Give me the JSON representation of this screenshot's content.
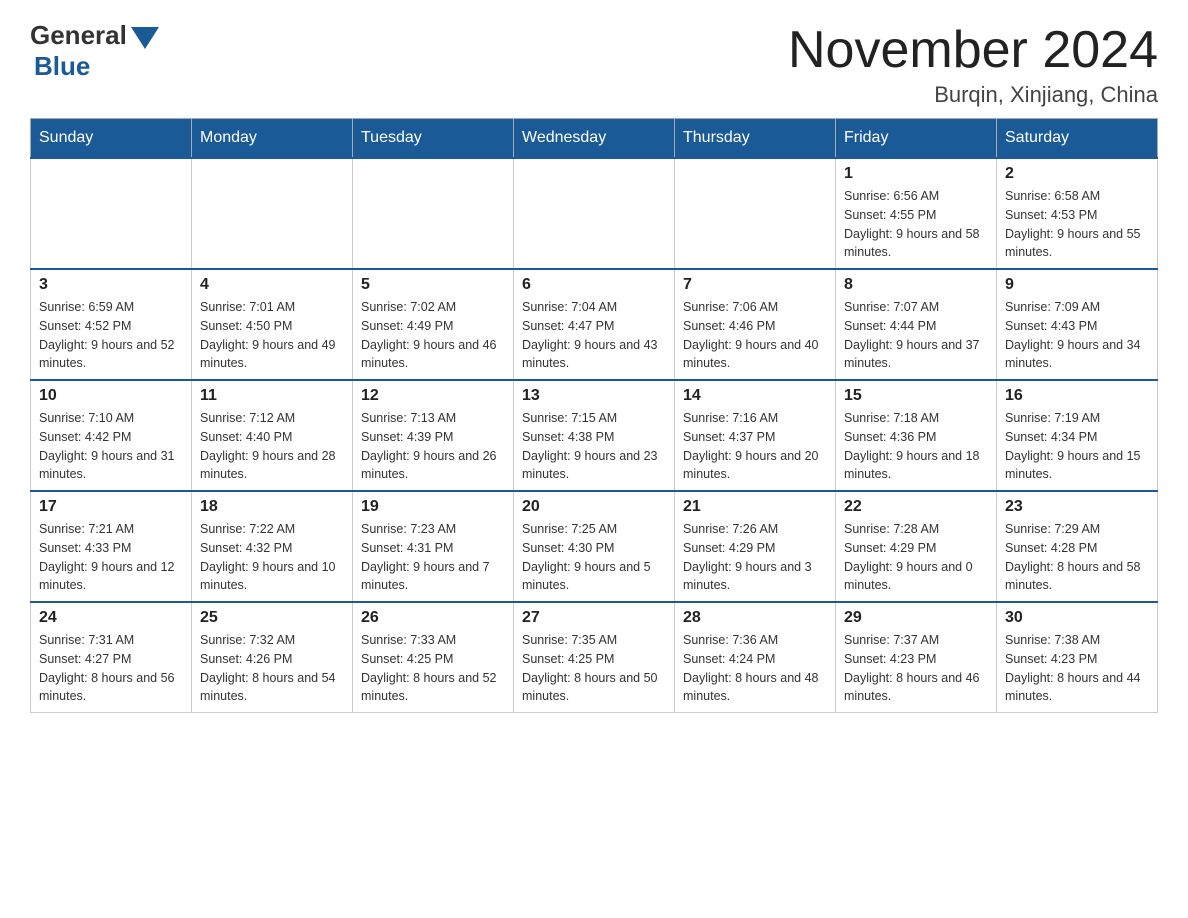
{
  "header": {
    "logo_general": "General",
    "logo_blue": "Blue",
    "month_title": "November 2024",
    "location": "Burqin, Xinjiang, China"
  },
  "weekdays": [
    "Sunday",
    "Monday",
    "Tuesday",
    "Wednesday",
    "Thursday",
    "Friday",
    "Saturday"
  ],
  "weeks": [
    {
      "days": [
        {
          "num": "",
          "empty": true
        },
        {
          "num": "",
          "empty": true
        },
        {
          "num": "",
          "empty": true
        },
        {
          "num": "",
          "empty": true
        },
        {
          "num": "",
          "empty": true
        },
        {
          "num": "1",
          "sunrise": "Sunrise: 6:56 AM",
          "sunset": "Sunset: 4:55 PM",
          "daylight": "Daylight: 9 hours and 58 minutes."
        },
        {
          "num": "2",
          "sunrise": "Sunrise: 6:58 AM",
          "sunset": "Sunset: 4:53 PM",
          "daylight": "Daylight: 9 hours and 55 minutes."
        }
      ]
    },
    {
      "days": [
        {
          "num": "3",
          "sunrise": "Sunrise: 6:59 AM",
          "sunset": "Sunset: 4:52 PM",
          "daylight": "Daylight: 9 hours and 52 minutes."
        },
        {
          "num": "4",
          "sunrise": "Sunrise: 7:01 AM",
          "sunset": "Sunset: 4:50 PM",
          "daylight": "Daylight: 9 hours and 49 minutes."
        },
        {
          "num": "5",
          "sunrise": "Sunrise: 7:02 AM",
          "sunset": "Sunset: 4:49 PM",
          "daylight": "Daylight: 9 hours and 46 minutes."
        },
        {
          "num": "6",
          "sunrise": "Sunrise: 7:04 AM",
          "sunset": "Sunset: 4:47 PM",
          "daylight": "Daylight: 9 hours and 43 minutes."
        },
        {
          "num": "7",
          "sunrise": "Sunrise: 7:06 AM",
          "sunset": "Sunset: 4:46 PM",
          "daylight": "Daylight: 9 hours and 40 minutes."
        },
        {
          "num": "8",
          "sunrise": "Sunrise: 7:07 AM",
          "sunset": "Sunset: 4:44 PM",
          "daylight": "Daylight: 9 hours and 37 minutes."
        },
        {
          "num": "9",
          "sunrise": "Sunrise: 7:09 AM",
          "sunset": "Sunset: 4:43 PM",
          "daylight": "Daylight: 9 hours and 34 minutes."
        }
      ]
    },
    {
      "days": [
        {
          "num": "10",
          "sunrise": "Sunrise: 7:10 AM",
          "sunset": "Sunset: 4:42 PM",
          "daylight": "Daylight: 9 hours and 31 minutes."
        },
        {
          "num": "11",
          "sunrise": "Sunrise: 7:12 AM",
          "sunset": "Sunset: 4:40 PM",
          "daylight": "Daylight: 9 hours and 28 minutes."
        },
        {
          "num": "12",
          "sunrise": "Sunrise: 7:13 AM",
          "sunset": "Sunset: 4:39 PM",
          "daylight": "Daylight: 9 hours and 26 minutes."
        },
        {
          "num": "13",
          "sunrise": "Sunrise: 7:15 AM",
          "sunset": "Sunset: 4:38 PM",
          "daylight": "Daylight: 9 hours and 23 minutes."
        },
        {
          "num": "14",
          "sunrise": "Sunrise: 7:16 AM",
          "sunset": "Sunset: 4:37 PM",
          "daylight": "Daylight: 9 hours and 20 minutes."
        },
        {
          "num": "15",
          "sunrise": "Sunrise: 7:18 AM",
          "sunset": "Sunset: 4:36 PM",
          "daylight": "Daylight: 9 hours and 18 minutes."
        },
        {
          "num": "16",
          "sunrise": "Sunrise: 7:19 AM",
          "sunset": "Sunset: 4:34 PM",
          "daylight": "Daylight: 9 hours and 15 minutes."
        }
      ]
    },
    {
      "days": [
        {
          "num": "17",
          "sunrise": "Sunrise: 7:21 AM",
          "sunset": "Sunset: 4:33 PM",
          "daylight": "Daylight: 9 hours and 12 minutes."
        },
        {
          "num": "18",
          "sunrise": "Sunrise: 7:22 AM",
          "sunset": "Sunset: 4:32 PM",
          "daylight": "Daylight: 9 hours and 10 minutes."
        },
        {
          "num": "19",
          "sunrise": "Sunrise: 7:23 AM",
          "sunset": "Sunset: 4:31 PM",
          "daylight": "Daylight: 9 hours and 7 minutes."
        },
        {
          "num": "20",
          "sunrise": "Sunrise: 7:25 AM",
          "sunset": "Sunset: 4:30 PM",
          "daylight": "Daylight: 9 hours and 5 minutes."
        },
        {
          "num": "21",
          "sunrise": "Sunrise: 7:26 AM",
          "sunset": "Sunset: 4:29 PM",
          "daylight": "Daylight: 9 hours and 3 minutes."
        },
        {
          "num": "22",
          "sunrise": "Sunrise: 7:28 AM",
          "sunset": "Sunset: 4:29 PM",
          "daylight": "Daylight: 9 hours and 0 minutes."
        },
        {
          "num": "23",
          "sunrise": "Sunrise: 7:29 AM",
          "sunset": "Sunset: 4:28 PM",
          "daylight": "Daylight: 8 hours and 58 minutes."
        }
      ]
    },
    {
      "days": [
        {
          "num": "24",
          "sunrise": "Sunrise: 7:31 AM",
          "sunset": "Sunset: 4:27 PM",
          "daylight": "Daylight: 8 hours and 56 minutes."
        },
        {
          "num": "25",
          "sunrise": "Sunrise: 7:32 AM",
          "sunset": "Sunset: 4:26 PM",
          "daylight": "Daylight: 8 hours and 54 minutes."
        },
        {
          "num": "26",
          "sunrise": "Sunrise: 7:33 AM",
          "sunset": "Sunset: 4:25 PM",
          "daylight": "Daylight: 8 hours and 52 minutes."
        },
        {
          "num": "27",
          "sunrise": "Sunrise: 7:35 AM",
          "sunset": "Sunset: 4:25 PM",
          "daylight": "Daylight: 8 hours and 50 minutes."
        },
        {
          "num": "28",
          "sunrise": "Sunrise: 7:36 AM",
          "sunset": "Sunset: 4:24 PM",
          "daylight": "Daylight: 8 hours and 48 minutes."
        },
        {
          "num": "29",
          "sunrise": "Sunrise: 7:37 AM",
          "sunset": "Sunset: 4:23 PM",
          "daylight": "Daylight: 8 hours and 46 minutes."
        },
        {
          "num": "30",
          "sunrise": "Sunrise: 7:38 AM",
          "sunset": "Sunset: 4:23 PM",
          "daylight": "Daylight: 8 hours and 44 minutes."
        }
      ]
    }
  ]
}
